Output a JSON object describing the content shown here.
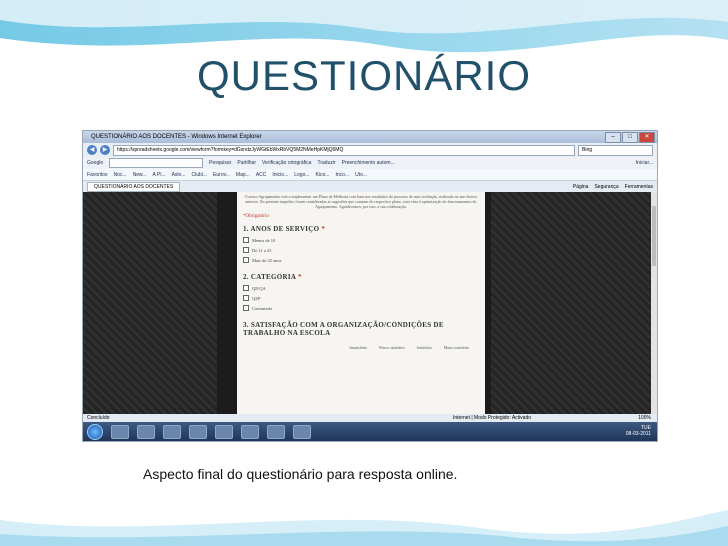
{
  "slide": {
    "title": "QUESTIONÁRIO",
    "caption": "Aspecto final do questionário para resposta online."
  },
  "browser": {
    "window_title": "QUESTIONÁRIO AOS DOCENTES - Windows Internet Explorer",
    "url": "https://spreadsheets.google.com/viewform?formkey=dGxndzJyWGtEbWxRbVQ5M2NMeHpKMjQ6MQ",
    "bing_placeholder": "Bing",
    "toolbar_google": "Google",
    "toolbar_items": [
      "Pesquisar",
      "Partilhar",
      "Verificação ortográfica",
      "Traduzir",
      "Preenchimento autom..."
    ],
    "toolbar_user": "Iniciar...",
    "favorites_label": "Favoritos",
    "favorites_items": [
      "Noc...",
      "New...",
      "A Pl...",
      "Aslo...",
      "Clubl...",
      "Eurov...",
      "Map...",
      "ACC",
      "Inicio...",
      "Logo...",
      "Kico...",
      "Inco...",
      "Uto..."
    ],
    "tab_label": "QUESTIONÁRIO AOS DOCENTES",
    "command_items": [
      "Página",
      "Segurança",
      "Ferramentas"
    ],
    "status_left": "Concluído",
    "status_zone": "Internet | Modo Protegido: Activado",
    "status_zoom": "100%"
  },
  "form": {
    "intro": "O nosso Agrupamento está a implementar um Plano de Melhoria com base nos resultados do processo de auto-avaliação, realizado no ano lectivo anterior. No presente inquérito foram consideradas as sugestões que constam do respectivo plano, com vista à optimização do funcionamento do Agrupamento. Agradecemos, por isso, a sua colaboração.",
    "required_note": "*Obrigatório",
    "q1_title": "1. ANOS DE SERVIÇO",
    "q1_options": [
      "Menos de 10",
      "De 11 a 25",
      "Mais de 25 anos"
    ],
    "q2_title": "2. CATEGORIA",
    "q2_options": [
      "QE/QA",
      "QZP",
      "Contratado"
    ],
    "q3_title": "3. SATISFAÇÃO COM A ORGANIZAÇÃO/CONDIÇÕES DE TRABALHO NA ESCOLA",
    "q3_scale": [
      "Insatisfeito",
      "Pouco satisfeito",
      "Satisfeito",
      "Muito satisfeito"
    ],
    "required_mark": "*"
  },
  "taskbar": {
    "clock_day": "TUE",
    "clock_date": "08-03-2011"
  },
  "colors": {
    "title": "#21506b",
    "wave": "#4fb3d9"
  }
}
